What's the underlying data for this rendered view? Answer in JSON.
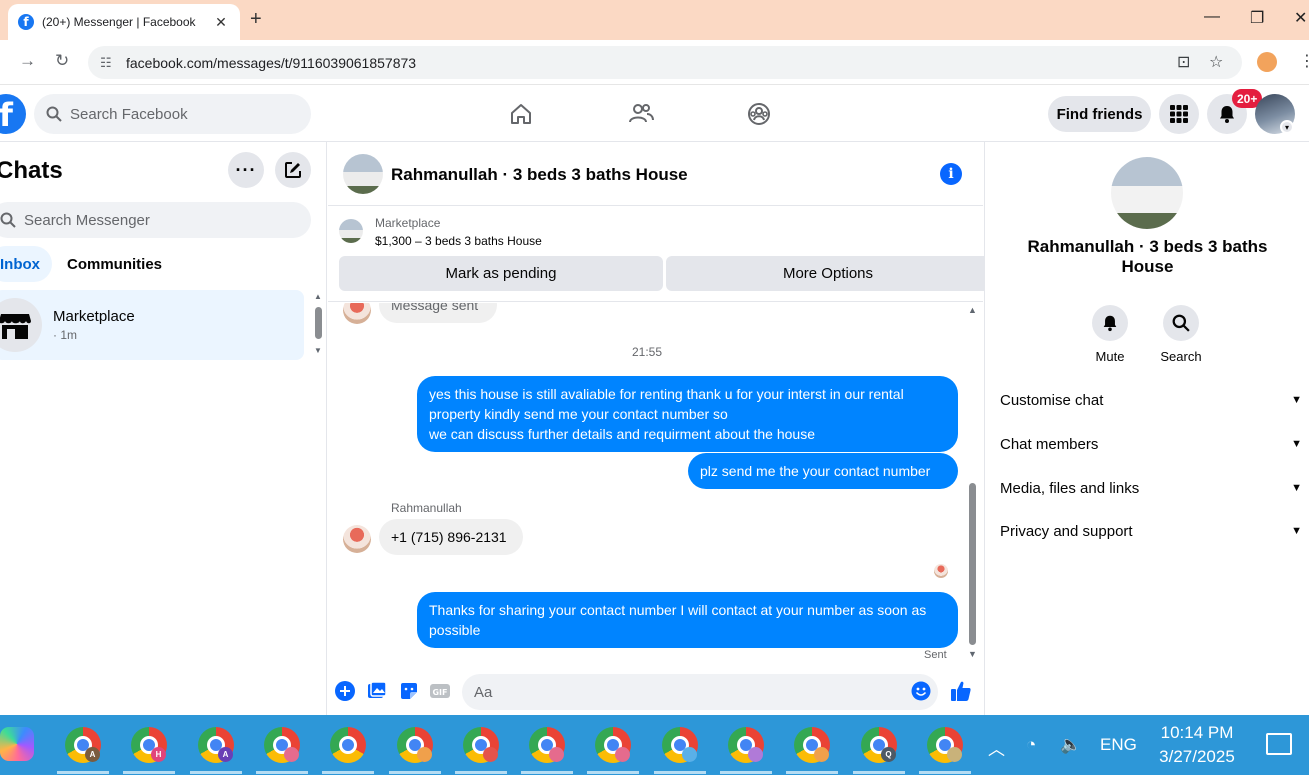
{
  "browser": {
    "tab_title": "(20+) Messenger | Facebook",
    "url": "facebook.com/messages/t/9116039061857873"
  },
  "fb_header": {
    "search_placeholder": "Search Facebook",
    "find_friends_label": "Find friends",
    "notification_badge": "20+"
  },
  "chat_list": {
    "title": "Chats",
    "search_placeholder": "Search Messenger",
    "tabs": [
      {
        "label": "Inbox",
        "active": true
      },
      {
        "label": "Communities",
        "active": false
      }
    ],
    "items": [
      {
        "name": "Marketplace",
        "time": "· 1m"
      }
    ]
  },
  "conversation": {
    "title": "Rahmanullah · 3 beds 3 baths House",
    "marketplace": {
      "label": "Marketplace",
      "item": "$1,300 – 3 beds 3 baths House",
      "button_pending": "Mark as pending",
      "button_more": "More Options"
    },
    "top_bubble_partial": "Message sent",
    "timestamp": "21:55",
    "messages": [
      {
        "from": "me",
        "text": "yes this house is still avaliable for renting thank u for your interst in our rental property kindly send me your contact number so\nwe can discuss further details and requirment about the house"
      },
      {
        "from": "me",
        "text": "plz send me the your contact number"
      },
      {
        "from": "them",
        "sender": "Rahmanullah",
        "text": "+1 (715) 896-2131"
      },
      {
        "from": "me",
        "text": "Thanks for sharing your contact number I will contact at your number as soon as possible"
      }
    ],
    "sent_label": "Sent",
    "composer_placeholder": "Aa"
  },
  "info_panel": {
    "name": "Rahmanullah · 3 beds 3 baths House",
    "actions": [
      {
        "label": "Mute",
        "icon": "bell-icon"
      },
      {
        "label": "Search",
        "icon": "search-icon"
      }
    ],
    "sections": [
      "Customise chat",
      "Chat members",
      "Media, files and links",
      "Privacy and support"
    ]
  },
  "taskbar": {
    "language": "ENG",
    "time": "10:14 PM",
    "date": "3/27/2025",
    "apps": [
      {
        "badge": "A",
        "badge_color": "#7a5c3e"
      },
      {
        "badge": "H",
        "badge_color": "#e0457b"
      },
      {
        "badge": "A",
        "badge_color": "#6a3fb5"
      },
      {
        "badge": "",
        "badge_color": "#e56b8d"
      },
      {
        "badge": "",
        "badge_color": ""
      },
      {
        "badge": "",
        "badge_color": "#f0a04b"
      },
      {
        "badge": "",
        "badge_color": "#e5534b"
      },
      {
        "badge": "",
        "badge_color": "#e56b8d"
      },
      {
        "badge": "",
        "badge_color": "#e56b8d"
      },
      {
        "badge": "",
        "badge_color": "#5ab0e8"
      },
      {
        "badge": "",
        "badge_color": "#b07ad8"
      },
      {
        "badge": "",
        "badge_color": "#f0a04b"
      },
      {
        "badge": "Q",
        "badge_color": "#4d5966"
      },
      {
        "badge": "",
        "badge_color": "#c9b27a"
      }
    ]
  }
}
